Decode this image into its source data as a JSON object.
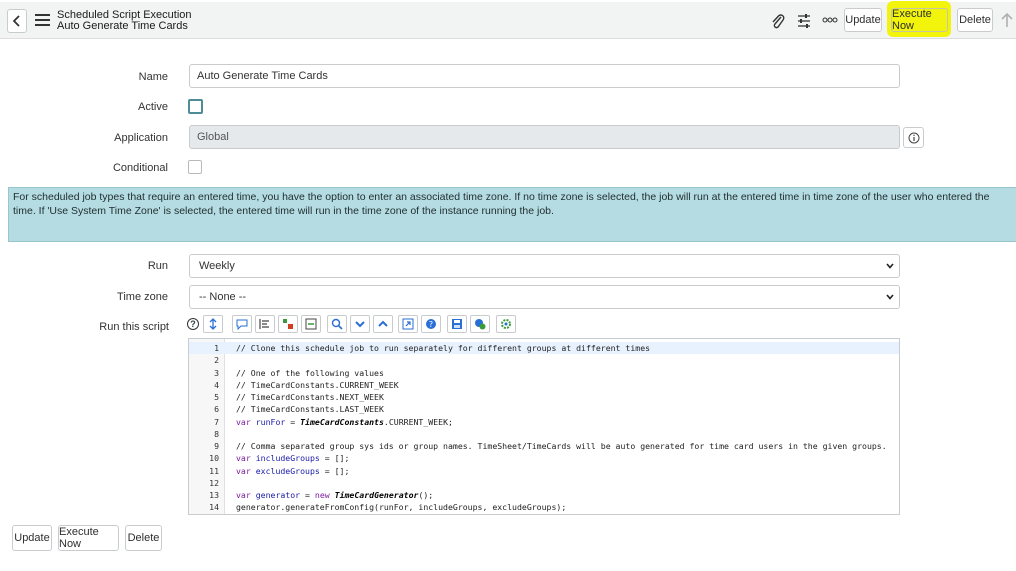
{
  "header": {
    "title": "Scheduled Script Execution",
    "subtitle": "Auto Generate Time Cards",
    "update_label": "Update",
    "execute_now_label": "Execute Now",
    "delete_label": "Delete"
  },
  "form": {
    "name_label": "Name",
    "name_value": "Auto Generate Time Cards",
    "active_label": "Active",
    "application_label": "Application",
    "application_value": "Global",
    "conditional_label": "Conditional",
    "info_text": "For scheduled job types that require an entered time, you have the option to enter an associated time zone. If no time zone is selected, the job will run at the entered time in time zone of the user who entered the time. If 'Use System Time Zone' is selected, the entered time will run in the time zone of the instance running the job.",
    "run_label": "Run",
    "run_value": "Weekly",
    "timezone_label": "Time zone",
    "timezone_value": "-- None --",
    "script_label": "Run this script"
  },
  "script_lines": [
    "// Clone this schedule job to run separately for different groups at different times",
    "",
    "// One of the following values",
    "// TimeCardConstants.CURRENT_WEEK",
    "// TimeCardConstants.NEXT_WEEK",
    "// TimeCardConstants.LAST_WEEK",
    "var runFor = TimeCardConstants.CURRENT_WEEK;",
    "",
    "// Comma separated group sys ids or group names. TimeSheet/TimeCards will be auto generated for time card users in the given groups.",
    "var includeGroups = [];",
    "var excludeGroups = [];",
    "",
    "var generator = new TimeCardGenerator();",
    "generator.generateFromConfig(runFor, includeGroups, excludeGroups);"
  ],
  "footer": {
    "update_label": "Update",
    "execute_now_label": "Execute Now",
    "delete_label": "Delete"
  },
  "colors": {
    "highlight": "#f2f40b",
    "info_bg": "#b4dce2",
    "header_bg": "#f2f3f3"
  }
}
